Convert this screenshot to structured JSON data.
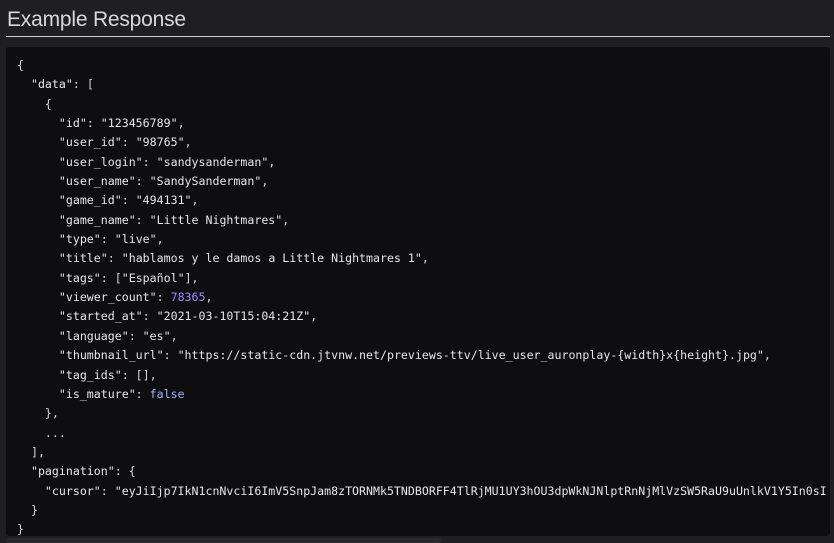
{
  "header": {
    "title": "Example Response"
  },
  "code": {
    "lines": [
      [
        {
          "t": "{",
          "c": "punct"
        }
      ],
      [
        {
          "t": "  ",
          "c": "punct"
        },
        {
          "t": "\"data\"",
          "c": "key"
        },
        {
          "t": ": [",
          "c": "punct"
        }
      ],
      [
        {
          "t": "    {",
          "c": "punct"
        }
      ],
      [
        {
          "t": "      ",
          "c": "punct"
        },
        {
          "t": "\"id\"",
          "c": "key"
        },
        {
          "t": ": ",
          "c": "punct"
        },
        {
          "t": "\"123456789\"",
          "c": "str"
        },
        {
          "t": ",",
          "c": "punct"
        }
      ],
      [
        {
          "t": "      ",
          "c": "punct"
        },
        {
          "t": "\"user_id\"",
          "c": "key"
        },
        {
          "t": ": ",
          "c": "punct"
        },
        {
          "t": "\"98765\"",
          "c": "str"
        },
        {
          "t": ",",
          "c": "punct"
        }
      ],
      [
        {
          "t": "      ",
          "c": "punct"
        },
        {
          "t": "\"user_login\"",
          "c": "key"
        },
        {
          "t": ": ",
          "c": "punct"
        },
        {
          "t": "\"sandysanderman\"",
          "c": "str"
        },
        {
          "t": ",",
          "c": "punct"
        }
      ],
      [
        {
          "t": "      ",
          "c": "punct"
        },
        {
          "t": "\"user_name\"",
          "c": "key"
        },
        {
          "t": ": ",
          "c": "punct"
        },
        {
          "t": "\"SandySanderman\"",
          "c": "str"
        },
        {
          "t": ",",
          "c": "punct"
        }
      ],
      [
        {
          "t": "      ",
          "c": "punct"
        },
        {
          "t": "\"game_id\"",
          "c": "key"
        },
        {
          "t": ": ",
          "c": "punct"
        },
        {
          "t": "\"494131\"",
          "c": "str"
        },
        {
          "t": ",",
          "c": "punct"
        }
      ],
      [
        {
          "t": "      ",
          "c": "punct"
        },
        {
          "t": "\"game_name\"",
          "c": "key"
        },
        {
          "t": ": ",
          "c": "punct"
        },
        {
          "t": "\"Little Nightmares\"",
          "c": "str"
        },
        {
          "t": ",",
          "c": "punct"
        }
      ],
      [
        {
          "t": "      ",
          "c": "punct"
        },
        {
          "t": "\"type\"",
          "c": "key"
        },
        {
          "t": ": ",
          "c": "punct"
        },
        {
          "t": "\"live\"",
          "c": "str"
        },
        {
          "t": ",",
          "c": "punct"
        }
      ],
      [
        {
          "t": "      ",
          "c": "punct"
        },
        {
          "t": "\"title\"",
          "c": "key"
        },
        {
          "t": ": ",
          "c": "punct"
        },
        {
          "t": "\"hablamos y le damos a Little Nightmares 1\"",
          "c": "str"
        },
        {
          "t": ",",
          "c": "punct"
        }
      ],
      [
        {
          "t": "      ",
          "c": "punct"
        },
        {
          "t": "\"tags\"",
          "c": "key"
        },
        {
          "t": ": [",
          "c": "punct"
        },
        {
          "t": "\"Español\"",
          "c": "str"
        },
        {
          "t": "],",
          "c": "punct"
        }
      ],
      [
        {
          "t": "      ",
          "c": "punct"
        },
        {
          "t": "\"viewer_count\"",
          "c": "key"
        },
        {
          "t": ": ",
          "c": "punct"
        },
        {
          "t": "78365",
          "c": "num"
        },
        {
          "t": ",",
          "c": "punct"
        }
      ],
      [
        {
          "t": "      ",
          "c": "punct"
        },
        {
          "t": "\"started_at\"",
          "c": "key"
        },
        {
          "t": ": ",
          "c": "punct"
        },
        {
          "t": "\"2021-03-10T15:04:21Z\"",
          "c": "str"
        },
        {
          "t": ",",
          "c": "punct"
        }
      ],
      [
        {
          "t": "      ",
          "c": "punct"
        },
        {
          "t": "\"language\"",
          "c": "key"
        },
        {
          "t": ": ",
          "c": "punct"
        },
        {
          "t": "\"es\"",
          "c": "str"
        },
        {
          "t": ",",
          "c": "punct"
        }
      ],
      [
        {
          "t": "      ",
          "c": "punct"
        },
        {
          "t": "\"thumbnail_url\"",
          "c": "key"
        },
        {
          "t": ": ",
          "c": "punct"
        },
        {
          "t": "\"https://static-cdn.jtvnw.net/previews-ttv/live_user_auronplay-{width}x{height}.jpg\"",
          "c": "str"
        },
        {
          "t": ",",
          "c": "punct"
        }
      ],
      [
        {
          "t": "      ",
          "c": "punct"
        },
        {
          "t": "\"tag_ids\"",
          "c": "key"
        },
        {
          "t": ": [],",
          "c": "punct"
        }
      ],
      [
        {
          "t": "      ",
          "c": "punct"
        },
        {
          "t": "\"is_mature\"",
          "c": "key"
        },
        {
          "t": ": ",
          "c": "punct"
        },
        {
          "t": "false",
          "c": "bool"
        }
      ],
      [
        {
          "t": "    },",
          "c": "punct"
        }
      ],
      [
        {
          "t": "    ...",
          "c": "punct"
        }
      ],
      [
        {
          "t": "  ],",
          "c": "punct"
        }
      ],
      [
        {
          "t": "  ",
          "c": "punct"
        },
        {
          "t": "\"pagination\"",
          "c": "key"
        },
        {
          "t": ": {",
          "c": "punct"
        }
      ],
      [
        {
          "t": "    ",
          "c": "punct"
        },
        {
          "t": "\"cursor\"",
          "c": "key"
        },
        {
          "t": ": ",
          "c": "punct"
        },
        {
          "t": "\"eyJiIjp7IkN1cnNvciI6ImV5SnpJam8zTORNMk5TNDBORFF4TlRjMU1UY3hOU3dpWkNJNlptRnNjMlVzSW5RaU9uUnlkV1Y5In0sI",
          "c": "str"
        }
      ],
      [
        {
          "t": "  }",
          "c": "punct"
        }
      ],
      [
        {
          "t": "}",
          "c": "punct"
        }
      ]
    ]
  },
  "colors": {
    "background": "#1f1f23",
    "code_background": "#0e0e10",
    "number": "#9f88ff",
    "boolean": "#9fb2ff"
  }
}
